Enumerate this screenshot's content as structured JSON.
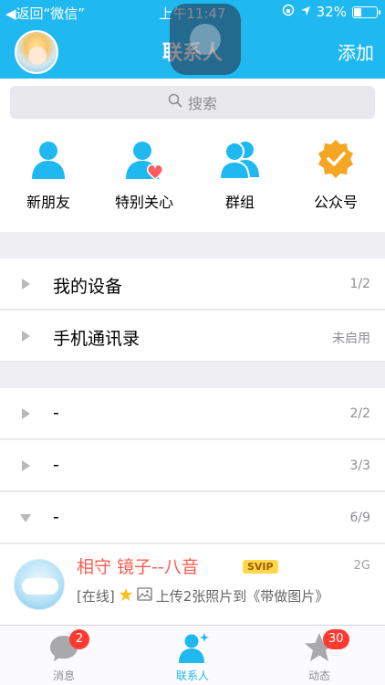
{
  "status_bar": {
    "back": "◀返回“微信”",
    "time": "上午11:47",
    "battery": "32%",
    "battery_level": 0.32
  },
  "nav": {
    "title": "联系人",
    "add": "添加"
  },
  "search": {
    "placeholder": "搜索"
  },
  "shortcuts": [
    {
      "label": "新朋友",
      "icon": "person-icon"
    },
    {
      "label": "特别关心",
      "icon": "person-heart-icon"
    },
    {
      "label": "群组",
      "icon": "group-icon"
    },
    {
      "label": "公众号",
      "icon": "official-account-icon"
    }
  ],
  "groups_top": [
    {
      "name": "我的设备",
      "count": "1/2"
    },
    {
      "name": "手机通讯录",
      "count": "未启用"
    }
  ],
  "groups": [
    {
      "name": "-",
      "count": "2/2"
    },
    {
      "name": "-",
      "count": "3/3"
    },
    {
      "name": "-",
      "count": "6/9"
    }
  ],
  "contact": {
    "name": "相守 镜子--八音",
    "badge": "SVIP",
    "network": "2G",
    "status_prefix": "[在线]",
    "status_text": "上传2张照片到《带做图片》"
  },
  "tabbar": [
    {
      "label": "消息",
      "badge": "2",
      "active": false
    },
    {
      "label": "联系人",
      "badge": "",
      "active": true
    },
    {
      "label": "动态",
      "badge": "30",
      "active": false
    }
  ],
  "colors": {
    "accent": "#1fb8f1",
    "badge": "#ff3b30",
    "contact_name": "#ff5a4e",
    "official_orange": "#f5a623"
  }
}
